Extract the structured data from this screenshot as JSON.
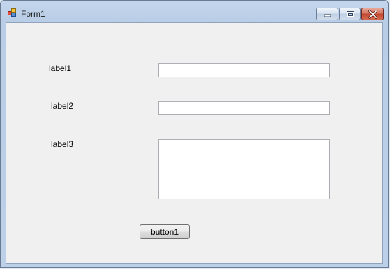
{
  "window": {
    "title": "Form1",
    "icon": "form-app-icon",
    "caption_buttons": [
      "minimize-icon",
      "maximize-icon",
      "close-icon"
    ]
  },
  "form": {
    "label1": "label1",
    "label2": "label2",
    "label3": "label3",
    "textbox1_value": "",
    "textbox2_value": "",
    "textbox3_value": "",
    "button1_label": "button1"
  },
  "colors": {
    "form_background": "#f0f0f0",
    "titlebar": "#bcd0e8",
    "close_button": "#c2472f"
  }
}
